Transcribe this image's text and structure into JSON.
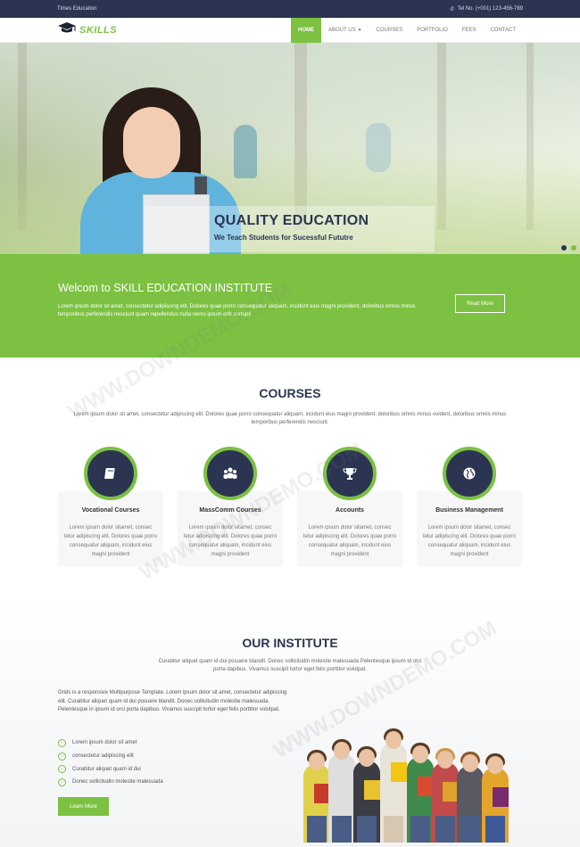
{
  "topbar": {
    "brand": "Times Education",
    "phone": "Tel No. (+001) 123-456-789"
  },
  "nav": {
    "logo": "SKILLS",
    "items": [
      {
        "label": "Home",
        "active": true
      },
      {
        "label": "About Us",
        "dropdown": true
      },
      {
        "label": "Courses"
      },
      {
        "label": "Portfolio"
      },
      {
        "label": "Fees"
      },
      {
        "label": "Contact"
      }
    ]
  },
  "hero": {
    "title": "QUALITY EDUCATION",
    "subtitle": "We Teach Students for Sucessful Fututre",
    "slides": 2,
    "active_slide": 1
  },
  "welcome": {
    "title": "Welcom to SKILL EDUCATION INSTITUTE",
    "text": "Lorem ipsum dolor sit amet, consectetur adipiscing elit. Dolores quae porro consequatur aliquam, incidunt eius magni provident, doloribus omnis minus temporibus perferendis nesciunt quam repellendus nulla nemo ipsum odit corrupti",
    "button": "Read More"
  },
  "courses": {
    "title": "COURSES",
    "description": "Lorem ipsum dolor sit amet, consectetur adipiscing elit. Dolores quae porro consequatur aliquam, incidunt eius magni provident, doloribus omnis minus ovident, doloribus omnis minus temporibus perferendis nesciunt.",
    "items": [
      {
        "name": "Vocational Courses",
        "icon": "book-icon",
        "text": "Lorem ipsum dolor sitamet, consec tetur adipiscing elit. Dolores quae porro consequatur aliquam, incidunt eius magni provident"
      },
      {
        "name": "MassComm Courses",
        "icon": "users-icon",
        "text": "Lorem ipsum dolor sitamet, consec tetur adipiscing elit. Dolores quae porro consequatur aliquam, incidunt eius magni provident"
      },
      {
        "name": "Accounts",
        "icon": "trophy-icon",
        "text": "Lorem ipsum dolor sitamet, consec tetur adipiscing elit. Dolores quae porro consequatur aliquam, incidunt eius magni provident"
      },
      {
        "name": "Business Management",
        "icon": "globe-icon",
        "text": "Lorem ipsum dolor sitamet, consec tetur adipiscing elit. Dolores quae porro consequatur aliquam, incidunt eius magni provident"
      }
    ]
  },
  "institute": {
    "title": "OUR INSTITUTE",
    "description": "Curabitur aliquet quam id dui posuere blandit. Donec sollicitudin molestie malesuada Pelentesque ipsum id orci porta dapibus. Vivamus suscipit tortor eget felis porttitor volutpat.",
    "text": "Grids is a responsive Multipurpose Template. Lorem ipsum dolor sit amet, consectetur adipiscing elit. Curabitur aliquet quam id dui posuere blandit. Donec sollicitudin molestie malesuada. Pelentesque in ipsum id orci porta dapibus. Vivamus suscipit tortor eget felis porttitor volutpat.",
    "checklist": [
      "Lorem ipsum dolor sit amet",
      "consectetur adipiscing elit",
      "Curabitur aliquet quam id dui",
      "Donec sollicitudin molestie malesuada"
    ],
    "button": "Learn More"
  },
  "watermark": "WWW.DOWNDEMO.COM",
  "colors": {
    "navy": "#2b3552",
    "green": "#7cc142"
  }
}
